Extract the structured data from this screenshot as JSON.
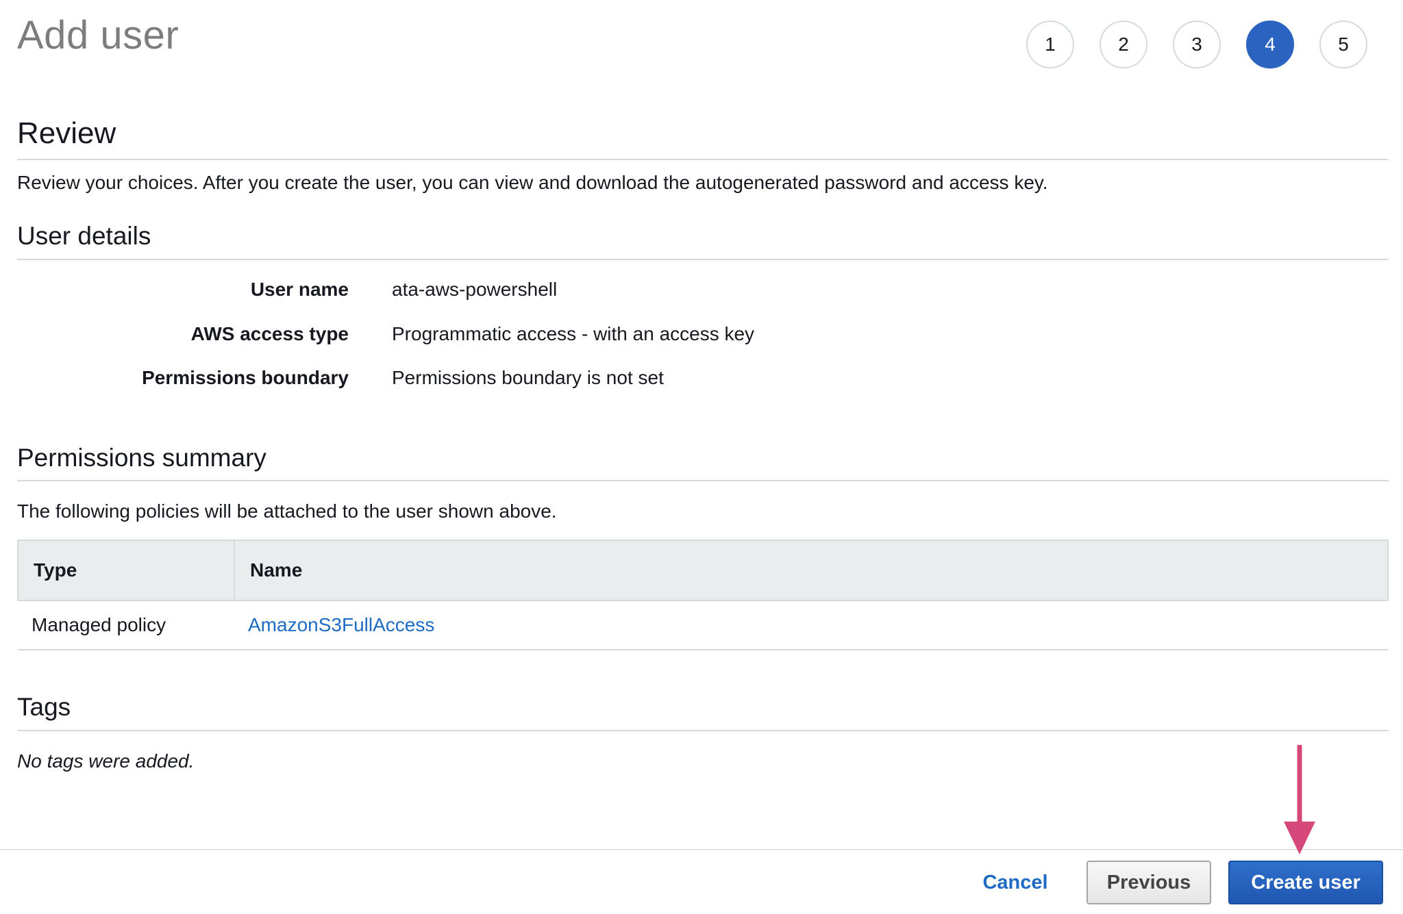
{
  "header": {
    "title": "Add user",
    "steps": [
      "1",
      "2",
      "3",
      "4",
      "5"
    ],
    "active_step": 4
  },
  "review": {
    "heading": "Review",
    "description": "Review your choices. After you create the user, you can view and download the autogenerated password and access key."
  },
  "user_details": {
    "heading": "User details",
    "rows": [
      {
        "label": "User name",
        "value": "ata-aws-powershell"
      },
      {
        "label": "AWS access type",
        "value": "Programmatic access - with an access key"
      },
      {
        "label": "Permissions boundary",
        "value": "Permissions boundary is not set"
      }
    ]
  },
  "permissions_summary": {
    "heading": "Permissions summary",
    "description": "The following policies will be attached to the user shown above.",
    "columns": [
      "Type",
      "Name"
    ],
    "rows": [
      {
        "type": "Managed policy",
        "name": "AmazonS3FullAccess"
      }
    ]
  },
  "tags": {
    "heading": "Tags",
    "empty_text": "No tags were added."
  },
  "footer": {
    "cancel_label": "Cancel",
    "previous_label": "Previous",
    "create_label": "Create user"
  },
  "annotation": {
    "arrow_color": "#d6477a",
    "arrow_icon": "arrow-down-icon"
  },
  "colors": {
    "accent": "#2b64c0",
    "link": "#1e6bc4"
  }
}
